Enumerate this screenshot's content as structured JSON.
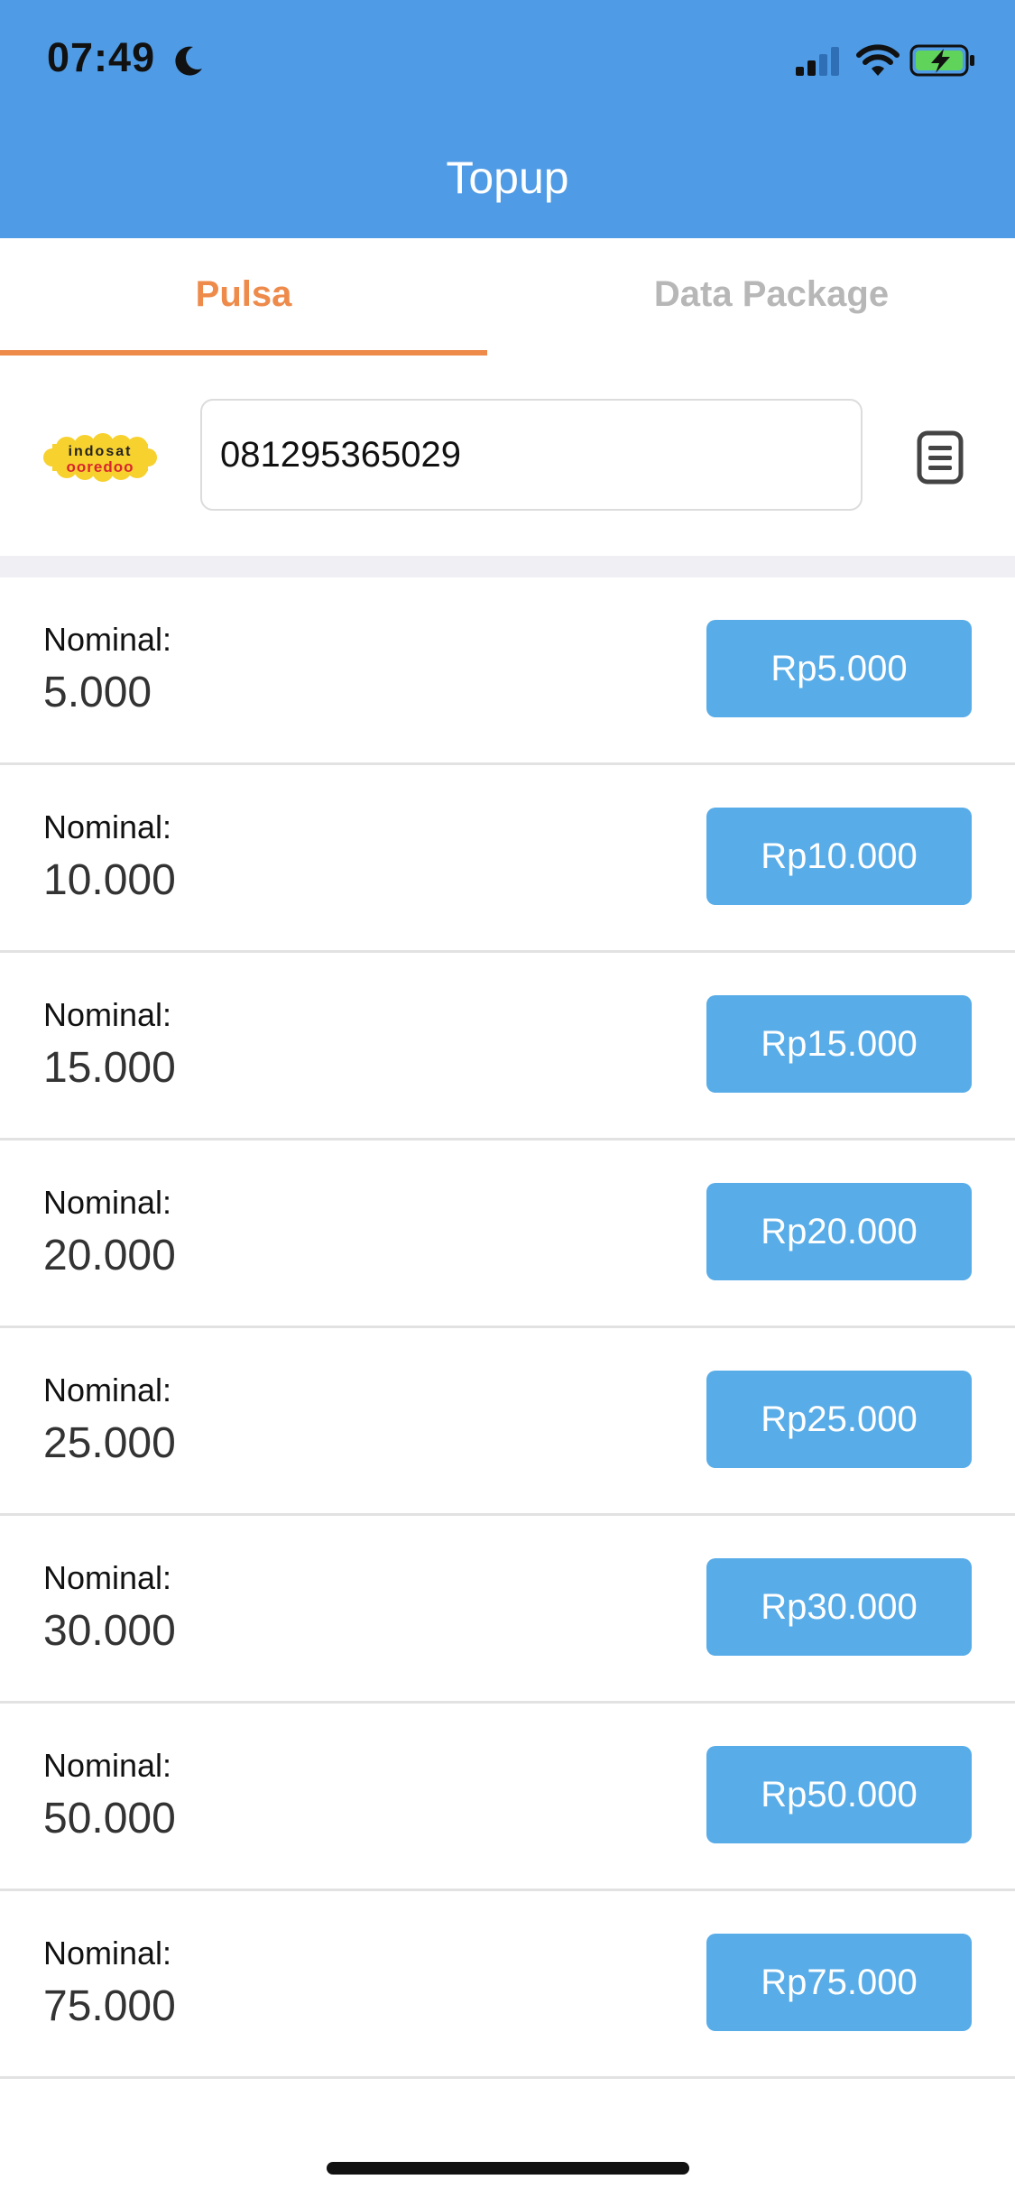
{
  "status_bar": {
    "time": "07:49",
    "icons": [
      "moon-icon",
      "signal-icon",
      "wifi-icon",
      "battery-charging-icon"
    ]
  },
  "header": {
    "title": "Topup"
  },
  "tabs": [
    {
      "label": "Pulsa",
      "active": true
    },
    {
      "label": "Data Package",
      "active": false
    }
  ],
  "phone": {
    "operator_logo_text_top": "indosat",
    "operator_logo_text_bottom": "ooredoo",
    "number": "081295365029",
    "contact_icon": "contact-book-icon"
  },
  "colors": {
    "header": "#4f9be5",
    "accent": "#ee8a4a",
    "button": "#58ace8",
    "inactive_tab": "#b7b7b7"
  },
  "list": [
    {
      "label": "Nominal:",
      "value": "5.000",
      "price": "Rp5.000"
    },
    {
      "label": "Nominal:",
      "value": "10.000",
      "price": "Rp10.000"
    },
    {
      "label": "Nominal:",
      "value": "15.000",
      "price": "Rp15.000"
    },
    {
      "label": "Nominal:",
      "value": "20.000",
      "price": "Rp20.000"
    },
    {
      "label": "Nominal:",
      "value": "25.000",
      "price": "Rp25.000"
    },
    {
      "label": "Nominal:",
      "value": "30.000",
      "price": "Rp30.000"
    },
    {
      "label": "Nominal:",
      "value": "50.000",
      "price": "Rp50.000"
    },
    {
      "label": "Nominal:",
      "value": "75.000",
      "price": "Rp75.000"
    }
  ]
}
